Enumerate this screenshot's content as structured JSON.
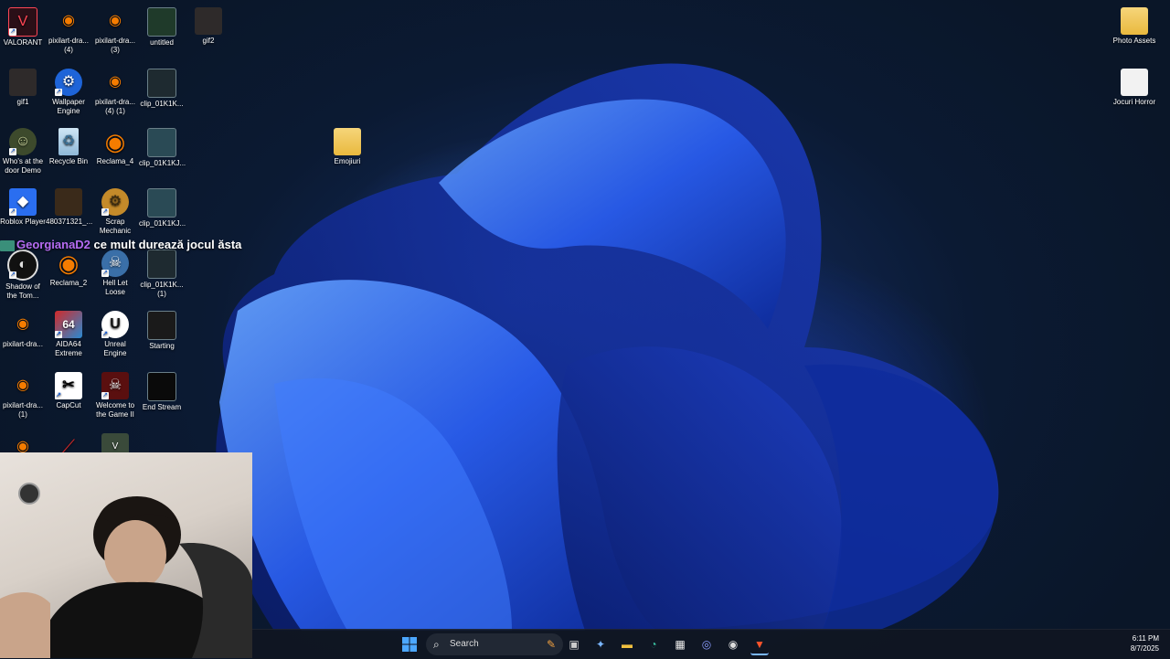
{
  "desktop_icons": [
    {
      "label": "VALORANT"
    },
    {
      "label": "pixilart-dra... (4)"
    },
    {
      "label": "pixilart-dra... (3)"
    },
    {
      "label": "untitled"
    },
    {
      "label": "gif2"
    },
    {
      "label": "gif1"
    },
    {
      "label": "Wallpaper Engine"
    },
    {
      "label": "pixilart-dra... (4) (1)"
    },
    {
      "label": "clip_01K1K..."
    },
    {
      "label": "Who's at the door Demo"
    },
    {
      "label": "Recycle Bin"
    },
    {
      "label": "Reclama_4"
    },
    {
      "label": "clip_01K1KJ..."
    },
    {
      "label": "Roblox Player"
    },
    {
      "label": "480371321_..."
    },
    {
      "label": "Scrap Mechanic"
    },
    {
      "label": "clip_01K1KJ..."
    },
    {
      "label": "Shadow of the Tom..."
    },
    {
      "label": "Reclama_2"
    },
    {
      "label": "Hell Let Loose"
    },
    {
      "label": "clip_01K1K... (1)"
    },
    {
      "label": "pixilart-dra..."
    },
    {
      "label": "AIDA64 Extreme"
    },
    {
      "label": "Unreal Engine"
    },
    {
      "label": "Starting"
    },
    {
      "label": "pixilart-dra... (1)"
    },
    {
      "label": "CapCut"
    },
    {
      "label": "Welcome to the Game II"
    },
    {
      "label": "End Stream"
    },
    {
      "label": "Emojiuri"
    },
    {
      "label": "Photo Assets"
    },
    {
      "label": "Jocuri Horror"
    }
  ],
  "chat": {
    "user": "GeorgianaD2",
    "message": "ce mult durează jocul ăsta"
  },
  "taskbar": {
    "search_placeholder": "Search",
    "time": "6:11 PM",
    "date": "8/7/2025"
  },
  "colors": {
    "accent": "#1a5fd6",
    "chat_user": "#b66cf2"
  }
}
